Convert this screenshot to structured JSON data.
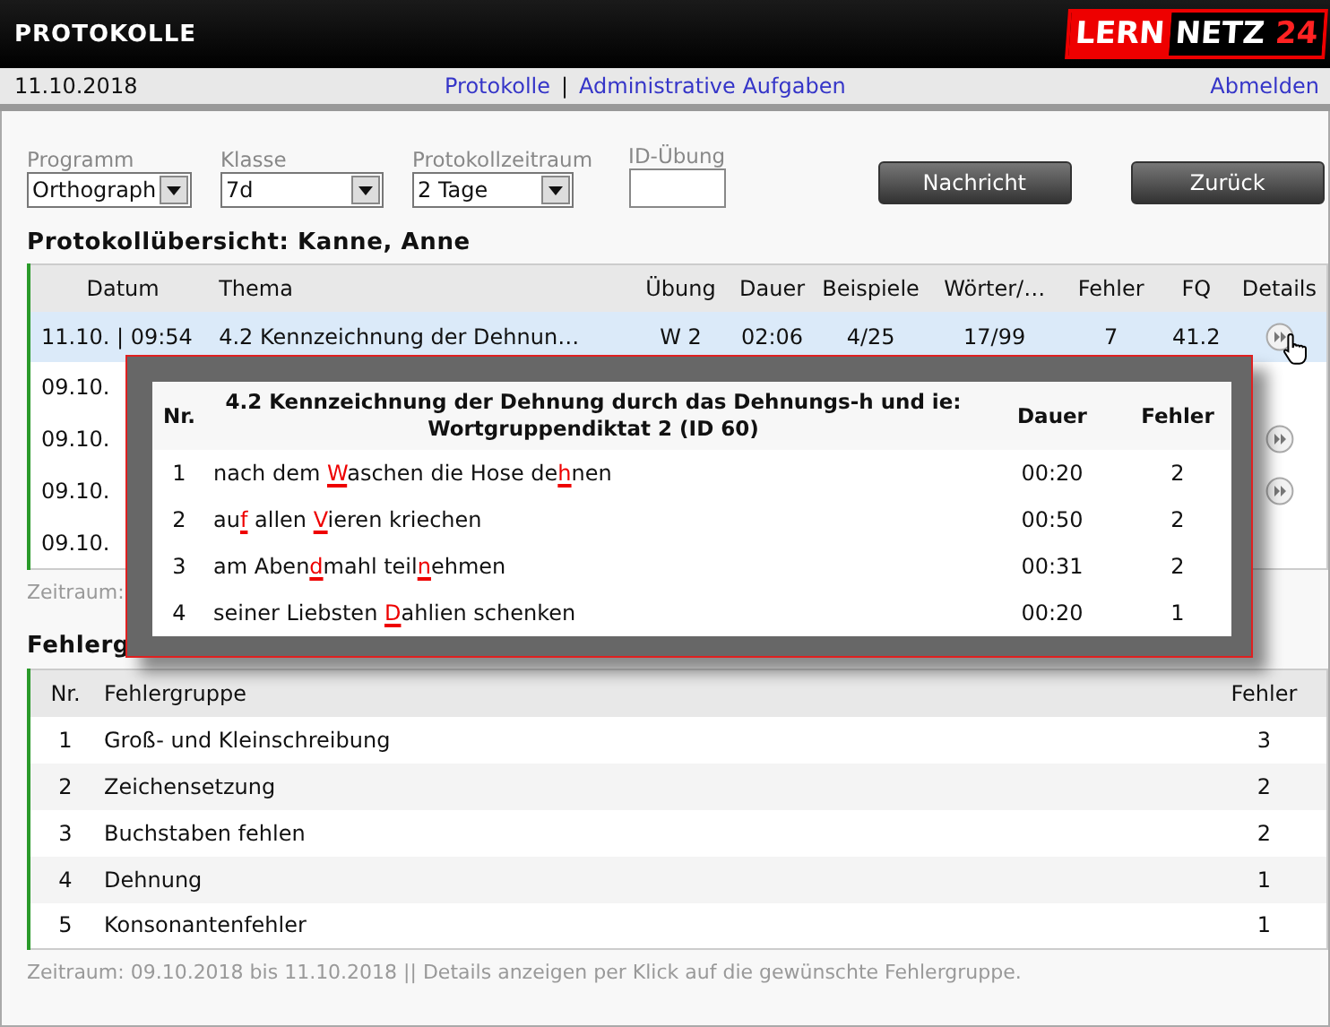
{
  "header": {
    "title": "PROTOKOLLE",
    "logo": {
      "left": "LERN",
      "middle": "NETZ",
      "number": "24"
    }
  },
  "nav": {
    "date": "11.10.2018",
    "links": [
      {
        "label": "Protokolle"
      },
      {
        "label": "Administrative Aufgaben"
      }
    ],
    "separator": "|",
    "logout": "Abmelden"
  },
  "filters": [
    {
      "kind": "select",
      "label": "Programm",
      "value": "Orthograph"
    },
    {
      "kind": "select",
      "label": "Klasse",
      "value": "7d"
    },
    {
      "kind": "select",
      "label": "Protokollzeitraum",
      "value": "2 Tage"
    },
    {
      "kind": "input",
      "label": "ID-Übung"
    }
  ],
  "buttons": [
    "Nachricht",
    "Zurück"
  ],
  "protocol": {
    "heading": "Protokollübersicht: Kanne, Anne",
    "columns": [
      "Datum",
      "Thema",
      "Übung",
      "Dauer",
      "Beispiele",
      "Wörter/…",
      "Fehler",
      "FQ",
      "Details"
    ],
    "rows": [
      {
        "selected": true,
        "details": true,
        "cells": [
          "11.10. | 09:54",
          "4.2 Kennzeichnung der Dehnun…",
          "W 2",
          "02:06",
          "4/25",
          "17/99",
          "7",
          "41.2"
        ]
      },
      {
        "selected": false,
        "details": false,
        "cells": [
          "09.10."
        ]
      },
      {
        "selected": false,
        "details": true,
        "cells": [
          "09.10."
        ]
      },
      {
        "selected": false,
        "details": true,
        "cells": [
          "09.10."
        ]
      },
      {
        "selected": false,
        "details": false,
        "cells": [
          "09.10."
        ]
      }
    ],
    "note": "Zeitraum:"
  },
  "popup": {
    "columns": {
      "number": "Nr.",
      "title": [
        "4.2 Kennzeichnung der Dehnung durch das Dehnungs-h und ie:",
        "Wortgruppendiktat 2 (ID 60)"
      ],
      "duration": "Dauer",
      "errors": "Fehler"
    },
    "rows": [
      {
        "number": "1",
        "segments": [
          {
            "text": "nach dem ",
            "error": false
          },
          {
            "text": "W",
            "error": true
          },
          {
            "text": "aschen die Hose de",
            "error": false
          },
          {
            "text": "h",
            "error": true
          },
          {
            "text": "nen",
            "error": false
          }
        ],
        "duration": "00:20",
        "errors": "2"
      },
      {
        "number": "2",
        "segments": [
          {
            "text": "au",
            "error": false
          },
          {
            "text": "f",
            "error": true
          },
          {
            "text": " allen ",
            "error": false
          },
          {
            "text": "V",
            "error": true
          },
          {
            "text": "ieren kriechen",
            "error": false
          }
        ],
        "duration": "00:50",
        "errors": "2"
      },
      {
        "number": "3",
        "segments": [
          {
            "text": "am Aben",
            "error": false
          },
          {
            "text": "d",
            "error": true
          },
          {
            "text": "mahl teil",
            "error": false
          },
          {
            "text": "n",
            "error": true
          },
          {
            "text": "ehmen",
            "error": false
          }
        ],
        "duration": "00:31",
        "errors": "2"
      },
      {
        "number": "4",
        "segments": [
          {
            "text": "seiner Liebsten ",
            "error": false
          },
          {
            "text": "D",
            "error": true
          },
          {
            "text": "ahlien schenken",
            "error": false
          }
        ],
        "duration": "00:20",
        "errors": "1"
      }
    ]
  },
  "errors": {
    "heading": "Fehlerg",
    "columns": [
      "Nr.",
      "Fehlergruppe",
      "Fehler"
    ],
    "rows": [
      {
        "cells": [
          "1",
          "Groß- und Kleinschreibung",
          "3"
        ]
      },
      {
        "cells": [
          "2",
          "Zeichensetzung",
          "2"
        ]
      },
      {
        "cells": [
          "3",
          "Buchstaben fehlen",
          "2"
        ]
      },
      {
        "cells": [
          "4",
          "Dehnung",
          "1"
        ]
      },
      {
        "cells": [
          "5",
          "Konsonantenfehler",
          "1"
        ]
      }
    ],
    "note": "Zeitraum: 09.10.2018 bis 11.10.2018 || Details anzeigen per Klick auf die gewünschte Fehlergruppe."
  }
}
